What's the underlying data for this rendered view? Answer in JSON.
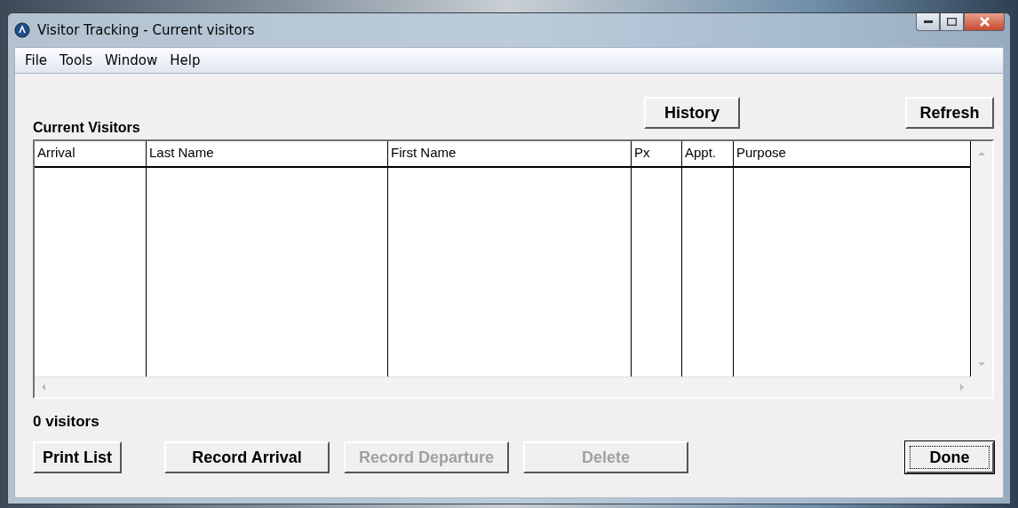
{
  "window": {
    "title": "Visitor Tracking - Current visitors"
  },
  "menu": [
    "File",
    "Tools",
    "Window",
    "Help"
  ],
  "heading": "Current Visitors",
  "top_buttons": [
    {
      "label": "History",
      "disabled": false
    },
    {
      "label": "Refresh",
      "disabled": false
    }
  ],
  "table": {
    "columns": [
      "Arrival",
      "Last Name",
      "First Name",
      "Px",
      "Appt.",
      "Purpose"
    ]
  },
  "status": "0 visitors",
  "bottom_buttons": [
    {
      "label": "Print List",
      "disabled": false,
      "default": false
    },
    {
      "label": "Record Arrival",
      "disabled": false,
      "default": false
    },
    {
      "label": "Record Departure",
      "disabled": true,
      "default": false
    },
    {
      "label": "Delete",
      "disabled": true,
      "default": false
    },
    {
      "label": "Done",
      "disabled": false,
      "default": true
    }
  ]
}
